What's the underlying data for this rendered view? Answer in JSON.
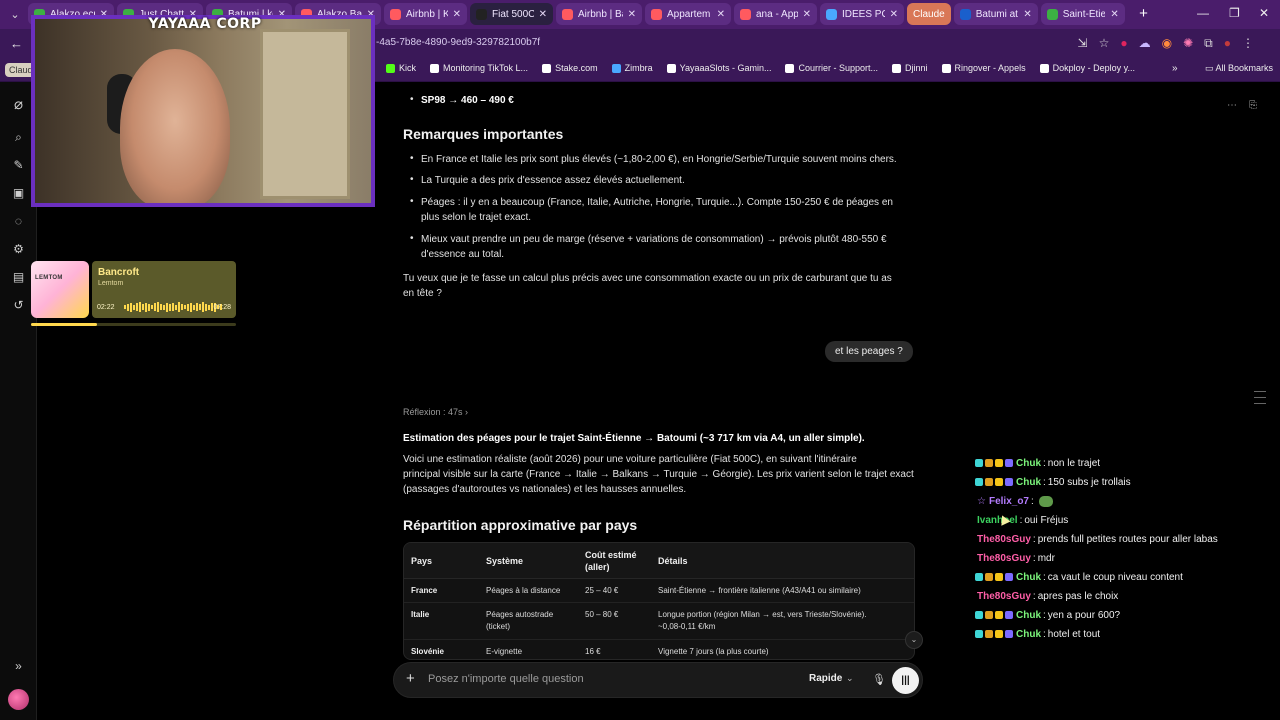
{
  "browser": {
    "tabs": [
      {
        "label": "Alakzo ecra",
        "color": "#3cb043"
      },
      {
        "label": "Just Chatti",
        "color": "#3cb043"
      },
      {
        "label": "Batumi | ko",
        "color": "#3cb043"
      },
      {
        "label": "Alakzo Bate",
        "color": "#ff5a5f"
      },
      {
        "label": "Airbnb | Ko",
        "color": "#ff5a5f"
      },
      {
        "label": "Fiat 500C fu",
        "color": "#222222"
      },
      {
        "label": "Airbnb | Ba",
        "color": "#ff5a5f"
      },
      {
        "label": "Appartem",
        "color": "#ff5a5f"
      },
      {
        "label": "ana - Appa",
        "color": "#ff5a5f"
      },
      {
        "label": "IDEES POUI",
        "color": "#4aa8ff"
      }
    ],
    "claude_tab": "Claude",
    "tabs_right": [
      {
        "label": "Batumi attr",
        "color": "#1a5fcc"
      },
      {
        "label": "Saint-Étien",
        "color": "#3cb043"
      }
    ],
    "url": "-4a5-7b8e-4890-9ed9-329782100b7f",
    "claude_pill": "Claude",
    "bookmarks": [
      {
        "label": "Kick",
        "color": "#53fc18"
      },
      {
        "label": "Monitoring TikTok L...",
        "color": "#ffffff"
      },
      {
        "label": "Stake.com",
        "color": "#ffffff"
      },
      {
        "label": "Zimbra",
        "color": "#4aa8ff"
      },
      {
        "label": "YayaaaSlots - Gamin...",
        "color": "#ffffff"
      },
      {
        "label": "Courrier - Support...",
        "color": "#ffffff"
      },
      {
        "label": "Djinni",
        "color": "#ffffff"
      },
      {
        "label": "Ringover - Appels",
        "color": "#ffffff"
      },
      {
        "label": "Dokploy - Deploy y...",
        "color": "#ffffff"
      }
    ],
    "all_bookmarks": "All Bookmarks"
  },
  "stream": {
    "overlay_title": "YAYAAA CORP",
    "music": {
      "album_text": "LEMTOM",
      "title": "Bancroft",
      "artist": "Lemtom",
      "time_current": "02:22",
      "time_total": "07:28",
      "progress": 0.32
    }
  },
  "chat_page": {
    "sp98_line": "SP98 → 460 – 490 €",
    "remarks_heading": "Remarques importantes",
    "remarks": [
      {
        "line1": "En France et Italie les prix sont plus élevés (~1,80-2,00 €), en Hongrie/Serbie/Turquie souvent moins chers.",
        "line2": ""
      },
      {
        "line1": "La Turquie a des prix d'essence assez élevés actuellement.",
        "line2": ""
      },
      {
        "line1": "Péages : il y en a beaucoup (France, Italie, Autriche, Hongrie, Turquie...). Compte 150-250 € de péages en",
        "line2": "plus selon le trajet exact."
      },
      {
        "line1": "Mieux vaut prendre un peu de marge (réserve + variations de consommation) → prévois plutôt 480-550 €",
        "line2": "d'essence au total."
      }
    ],
    "question_line1": "Tu veux que je te fasse un calcul plus précis avec une consommation exacte ou un prix de carburant que tu as",
    "question_line2": "en tête ?",
    "user_message": "et les peages ?",
    "reflexion": "Réflexion : 47s ›",
    "estimation_title": "Estimation des péages pour le trajet Saint-Étienne → Batoumi (~3 717 km via A4, un aller simple).",
    "estimation_lines": [
      "Voici une estimation réaliste (août 2026) pour une voiture particulière (Fiat 500C), en suivant l'itinéraire",
      "principal visible sur la carte (France → Italie → Balkans → Turquie → Géorgie). Les prix varient selon le trajet exact",
      "(passages d'autoroutes vs nationales) et les hausses annuelles."
    ],
    "table_heading": "Répartition approximative par pays",
    "table": {
      "headers": [
        "Pays",
        "Système",
        "Coût estimé (aller)",
        "Détails"
      ],
      "rows": [
        {
          "pays": "France",
          "systeme": "Péages à la distance",
          "systeme2": "",
          "cout": "25 – 40 €",
          "details": "Saint-Étienne → frontière italienne (A43/A41 ou similaire)",
          "details2": ""
        },
        {
          "pays": "Italie",
          "systeme": "Péages autostrade",
          "systeme2": "(ticket)",
          "cout": "50 – 80 €",
          "details": "Longue portion (région Milan → est, vers Trieste/Slovénie).",
          "details2": "~0,08-0,11 €/km"
        },
        {
          "pays": "Slovénie",
          "systeme": "E-vignette",
          "systeme2": "",
          "cout": "16 €",
          "details": "Vignette 7 jours (la plus courte)",
          "details2": ""
        }
      ]
    },
    "composer": {
      "placeholder": "Posez n'importe quelle question",
      "model": "Rapide"
    }
  },
  "twitch_chat": [
    {
      "user": "Chuk",
      "color": "#7cf57c",
      "text": "non le trajet",
      "badges": true
    },
    {
      "user": "Chuk",
      "color": "#7cf57c",
      "text": "150 subs je trollais",
      "badges": true
    },
    {
      "user": "Felix_o7",
      "color": "#b47cff",
      "text": ":",
      "badges": false,
      "emote": true
    },
    {
      "user": "Ivanhoel",
      "color": "#3cd15f",
      "text": "oui Fréjus",
      "badges": false
    },
    {
      "user": "The80sGuy",
      "color": "#ff5fa8",
      "text": "prends full petites routes pour aller labas",
      "badges": false
    },
    {
      "user": "The80sGuy",
      "color": "#ff5fa8",
      "text": "mdr",
      "badges": false
    },
    {
      "user": "Chuk",
      "color": "#7cf57c",
      "text": "ca vaut le coup niveau content",
      "badges": true
    },
    {
      "user": "The80sGuy",
      "color": "#ff5fa8",
      "text": "apres pas le choix",
      "badges": false
    },
    {
      "user": "Chuk",
      "color": "#7cf57c",
      "text": "yen a pour 600?",
      "badges": true
    },
    {
      "user": "Chuk",
      "color": "#7cf57c",
      "text": "hotel et tout",
      "badges": true
    }
  ]
}
